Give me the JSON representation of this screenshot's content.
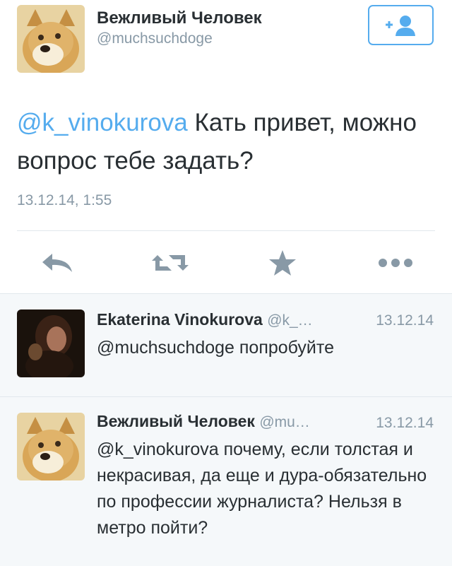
{
  "tweet": {
    "author_name": "Вежливый Человек",
    "author_handle": "@muchsuchdoge",
    "mention": "@k_vinokurova",
    "text": " Кать привет, можно вопрос тебе задать?",
    "timestamp": "13.12.14, 1:55"
  },
  "actions": {
    "reply_icon": "reply-icon",
    "retweet_icon": "retweet-icon",
    "favorite_icon": "star-icon",
    "more_icon": "more-dots-icon"
  },
  "replies": [
    {
      "author_name": "Ekaterina Vinokurova",
      "author_handle": "@k_…",
      "date": "13.12.14",
      "text": "@muchsuchdoge попробуйте"
    },
    {
      "author_name": "Вежливый Человек",
      "author_handle": "@mu…",
      "date": "13.12.14",
      "text": "@k_vinokurova почему,  если толстая и некрасивая, да еще и дура-обязательно по профессии журналиста? Нельзя в метро пойти?"
    }
  ],
  "colors": {
    "accent": "#55acee",
    "muted": "#8899a6",
    "text": "#292f33",
    "reply_bg": "#f5f8fa"
  }
}
